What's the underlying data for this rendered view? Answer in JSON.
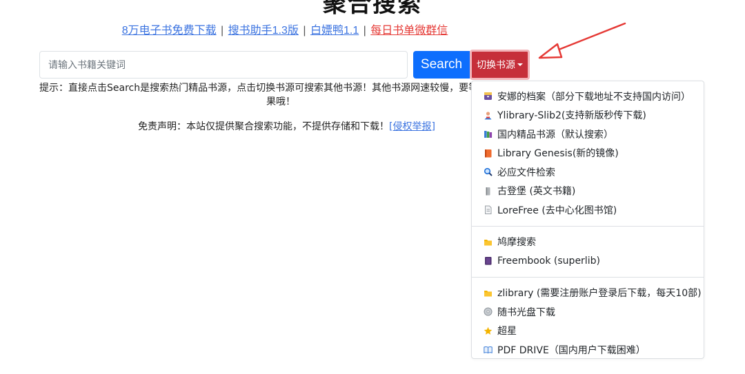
{
  "header": {
    "title": "聚合搜索",
    "links": [
      {
        "label": "8万电子书免费下载"
      },
      {
        "label": "搜书助手1.3版"
      },
      {
        "label": "白嫖鸭1.1"
      },
      {
        "label": "每日书单微群信"
      }
    ],
    "separator": "|"
  },
  "search": {
    "placeholder": "请输入书籍关键词",
    "value": "",
    "button_label": "Search",
    "switch_label": "切换书源"
  },
  "hint": {
    "line1": "提示：直接点击Search是搜索热门精品书源，点击切换书源可搜索其他书源！其他书源网速较慢，要等",
    "line2": "果哦！"
  },
  "disclaimer": {
    "text": "免责声明：本站仅提供聚合搜索功能，不提供存储和下载！",
    "link": "[侵权举报]"
  },
  "colors": {
    "primary": "#0d6efd",
    "danger": "#c62f3a",
    "link": "#3b73e0",
    "link_red": "#e53935",
    "arrow": "#e53935"
  },
  "dropdown": {
    "groups": [
      [
        {
          "icon": "archive-box-icon",
          "label": "安娜的档案（部分下载地址不支持国内访问）"
        },
        {
          "icon": "person-icon",
          "label": "Ylibrary-Slib2(支持新版秒传下载)"
        },
        {
          "icon": "books-icon",
          "label": "国内精品书源（默认搜索）"
        },
        {
          "icon": "book-icon",
          "label": "Library Genesis(新的镜像)"
        },
        {
          "icon": "magnifier-icon",
          "label": "必应文件检索"
        },
        {
          "icon": "scroll-icon",
          "label": "古登堡 (英文书籍)"
        },
        {
          "icon": "page-icon",
          "label": "LoreFree (去中心化图书馆)"
        }
      ],
      [
        {
          "icon": "folder-icon",
          "label": "鸠摩搜索"
        },
        {
          "icon": "notebook-icon",
          "label": "Freembook (superlib)"
        }
      ],
      [
        {
          "icon": "folder-icon",
          "label": "zlibrary (需要注册账户登录后下载，每天10部)"
        },
        {
          "icon": "disc-icon",
          "label": "随书光盘下载"
        },
        {
          "icon": "star-icon",
          "label": "超星"
        },
        {
          "icon": "open-book-icon",
          "label": "PDF DRIVE（国内用户下载困难）"
        }
      ]
    ]
  }
}
